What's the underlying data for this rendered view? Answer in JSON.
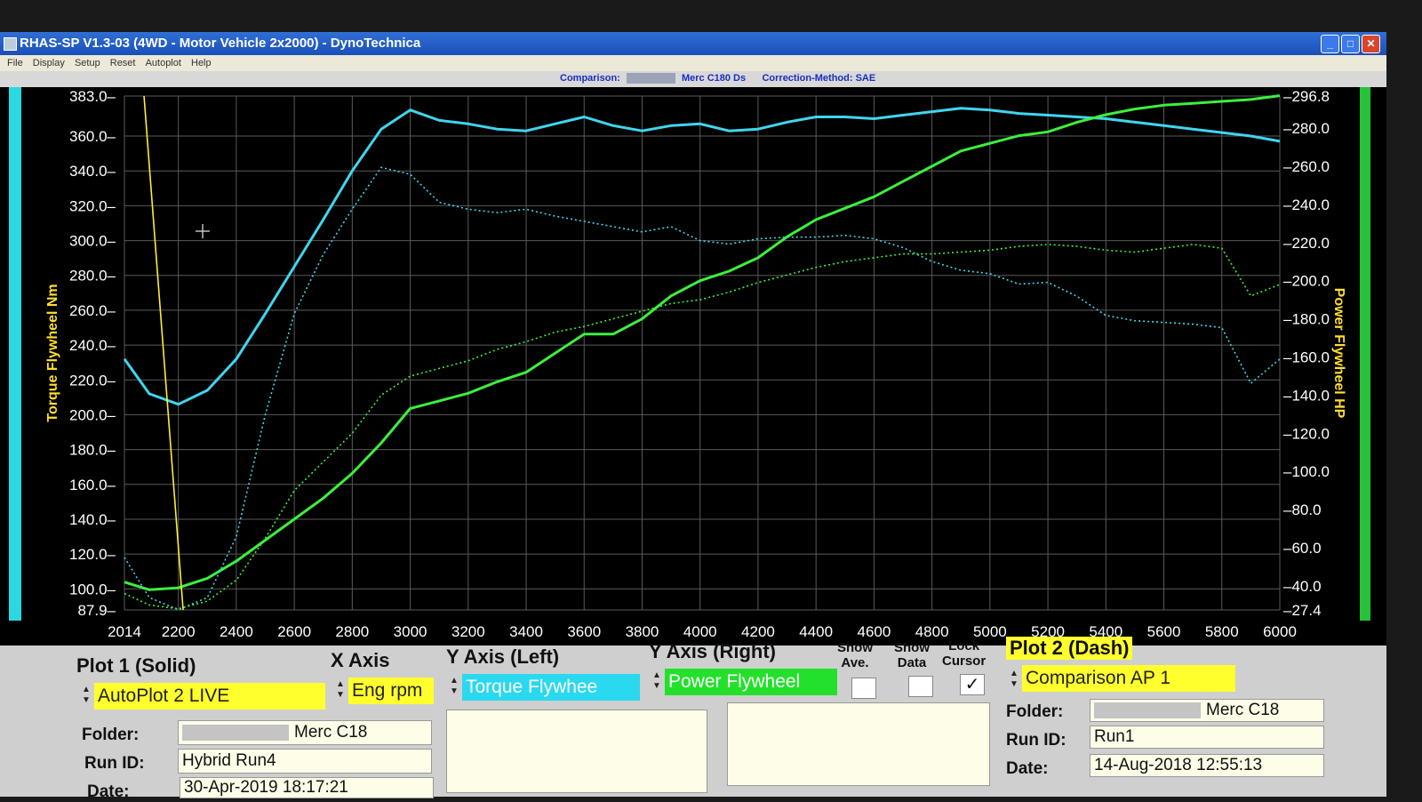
{
  "window": {
    "title": "RHAS-SP V1.3-03  (4WD - Motor Vehicle 2x2000) - DynoTechnica",
    "menu": [
      "File",
      "Display",
      "Setup",
      "Reset",
      "Autoplot",
      "Help"
    ],
    "controls": {
      "minimize": "_",
      "maximize": "□",
      "close": "✕"
    }
  },
  "infobar": {
    "comparison_label": "Comparison:",
    "vehicle": "Merc C180 Ds",
    "correction": "Correction-Method: SAE"
  },
  "chart_data": {
    "type": "line",
    "xlabel": "",
    "ylabel_left": "Torque Flywheel Nm",
    "ylabel_right": "Power Flywheel HP",
    "x_ticks": [
      "2014",
      "2200",
      "2400",
      "2600",
      "2800",
      "3000",
      "3200",
      "3400",
      "3600",
      "3800",
      "4000",
      "4200",
      "4400",
      "4600",
      "4800",
      "5000",
      "5200",
      "5400",
      "5600",
      "5800",
      "6000"
    ],
    "y_left_ticks": [
      "383.0",
      "360.0",
      "340.0",
      "320.0",
      "300.0",
      "280.0",
      "260.0",
      "240.0",
      "220.0",
      "200.0",
      "180.0",
      "160.0",
      "140.0",
      "120.0",
      "100.0",
      "87.9"
    ],
    "y_right_ticks": [
      "296.8",
      "280.0",
      "260.0",
      "240.0",
      "220.0",
      "200.0",
      "180.0",
      "160.0",
      "140.0",
      "120.0",
      "100.0",
      "80.0",
      "60.0",
      "40.0",
      "27.4"
    ],
    "xlim": [
      2014,
      6000
    ],
    "ylim_left": [
      87.9,
      383.0
    ],
    "ylim_right": [
      27.4,
      296.8
    ],
    "grid": true,
    "cursor_x": 2100,
    "series": [
      {
        "axis": "left",
        "style": "solid",
        "color": "#3fd6ee",
        "x": [
          2014,
          2100,
          2200,
          2300,
          2400,
          2500,
          2600,
          2700,
          2800,
          2900,
          3000,
          3100,
          3200,
          3300,
          3400,
          3500,
          3600,
          3700,
          3800,
          3900,
          4000,
          4100,
          4200,
          4300,
          4400,
          4500,
          4600,
          4700,
          4800,
          4900,
          5000,
          5100,
          5200,
          5300,
          5400,
          5500,
          5600,
          5700,
          5800,
          5900,
          6000
        ],
        "y": [
          232,
          212,
          206,
          214,
          232,
          258,
          285,
          312,
          340,
          364,
          375,
          369,
          367,
          364,
          363,
          367,
          371,
          366,
          363,
          366,
          367,
          363,
          364,
          368,
          371,
          371,
          370,
          372,
          374,
          376,
          375,
          373,
          372,
          371,
          370,
          368,
          366,
          364,
          362,
          360,
          357
        ]
      },
      {
        "axis": "right",
        "style": "solid",
        "color": "#3cf03c",
        "x": [
          2014,
          2100,
          2200,
          2300,
          2400,
          2500,
          2600,
          2700,
          2800,
          2900,
          3000,
          3100,
          3200,
          3300,
          3400,
          3500,
          3600,
          3700,
          3800,
          3900,
          4000,
          4100,
          4200,
          4300,
          4400,
          4500,
          4600,
          4700,
          4800,
          4900,
          5000,
          5100,
          5200,
          5300,
          5400,
          5500,
          5600,
          5700,
          5800,
          5900,
          6000
        ],
        "y": [
          42,
          38,
          39,
          44,
          53,
          64,
          75,
          86,
          99,
          115,
          133,
          137,
          141,
          147,
          152,
          162,
          172,
          172,
          180,
          192,
          200,
          205,
          212,
          223,
          232,
          238,
          244,
          252,
          260,
          268,
          272,
          276,
          278,
          283,
          287,
          290,
          292,
          293,
          294,
          295,
          297
        ]
      },
      {
        "axis": "left",
        "style": "dotted",
        "color": "#3fd6ee",
        "x": [
          2014,
          2100,
          2200,
          2300,
          2400,
          2500,
          2600,
          2700,
          2800,
          2900,
          3000,
          3100,
          3200,
          3300,
          3400,
          3500,
          3600,
          3700,
          3800,
          3900,
          4000,
          4100,
          4200,
          4300,
          4400,
          4500,
          4600,
          4700,
          4800,
          4900,
          5000,
          5100,
          5200,
          5300,
          5400,
          5500,
          5600,
          5700,
          5800,
          5900,
          6000
        ],
        "y": [
          118,
          95,
          88,
          95,
          130,
          200,
          258,
          292,
          318,
          342,
          338,
          322,
          318,
          316,
          318,
          314,
          311,
          308,
          305,
          308,
          300,
          298,
          301,
          302,
          302,
          303,
          301,
          296,
          288,
          283,
          281,
          275,
          276,
          268,
          257,
          254,
          253,
          252,
          250,
          218,
          232
        ]
      },
      {
        "axis": "right",
        "style": "dotted",
        "color": "#3cf03c",
        "x": [
          2014,
          2100,
          2200,
          2300,
          2400,
          2500,
          2600,
          2700,
          2800,
          2900,
          3000,
          3100,
          3200,
          3300,
          3400,
          3500,
          3600,
          3700,
          3800,
          3900,
          4000,
          4100,
          4200,
          4300,
          4400,
          4500,
          4600,
          4700,
          4800,
          4900,
          5000,
          5100,
          5200,
          5300,
          5400,
          5500,
          5600,
          5700,
          5800,
          5900,
          6000
        ],
        "y": [
          36,
          30,
          28,
          32,
          43,
          65,
          90,
          105,
          120,
          140,
          150,
          154,
          158,
          164,
          168,
          173,
          176,
          180,
          184,
          188,
          190,
          194,
          199,
          203,
          207,
          210,
          212,
          214,
          214,
          215,
          216,
          218,
          219,
          218,
          216,
          215,
          217,
          219,
          217,
          192,
          198
        ]
      }
    ]
  },
  "panel": {
    "plot1": {
      "title": "Plot 1 (Solid)",
      "selection": "AutoPlot 2 LIVE",
      "folder_label": "Folder:",
      "folder_value": "Merc C18",
      "runid_label": "Run ID:",
      "runid_value": "Hybrid Run4",
      "date_label": "Date:",
      "date_value": "30-Apr-2019   18:17:21"
    },
    "x_axis": {
      "title": "X Axis",
      "selection": "Eng rpm"
    },
    "y_left": {
      "title": "Y Axis (Left)",
      "selection": "Torque Flywhee"
    },
    "y_right": {
      "title": "Y Axis (Right)",
      "selection": "Power Flywheel"
    },
    "show_ave": {
      "line1": "Show",
      "line2": "Ave.",
      "checked": ""
    },
    "show_data": {
      "line1": "Show",
      "line2": "Data",
      "checked": ""
    },
    "lock_cursor": {
      "line1": "Lock",
      "line2": "Cursor",
      "checked": "✓"
    },
    "plot2": {
      "title": "Plot 2 (Dash)",
      "selection": "Comparison AP 1",
      "folder_label": "Folder:",
      "folder_value": "Merc C18",
      "runid_label": "Run ID:",
      "runid_value": "Run1",
      "date_label": "Date:",
      "date_value": "14-Aug-2018   12:55:13"
    }
  }
}
